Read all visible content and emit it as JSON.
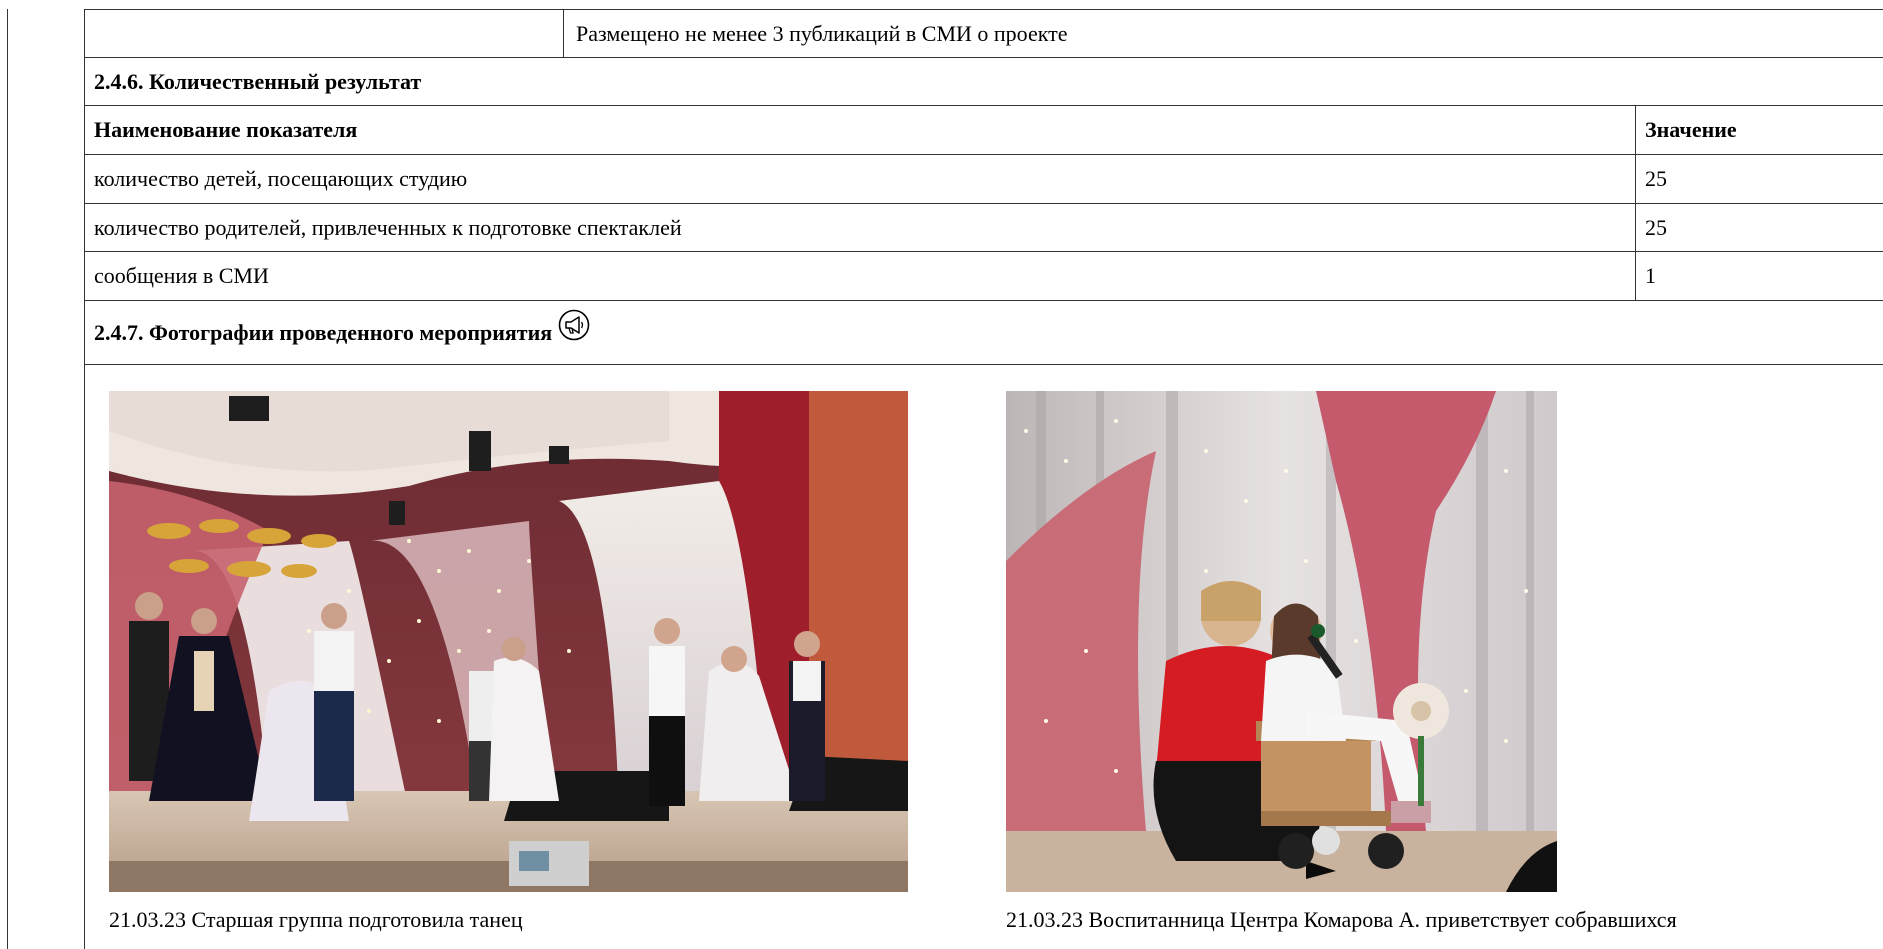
{
  "rows": {
    "publications_note": "Размещено не менее 3 публикаций в СМИ о проекте",
    "quant_section_title": "2.4.6. Количественный результат",
    "indicators_header": {
      "name": "Наименование показателя",
      "value": "Значение"
    },
    "indicators": [
      {
        "name": "количество детей, посещающих студию",
        "value": "25"
      },
      {
        "name": "количество родителей, привлеченных к подготовке спектаклей",
        "value": "25"
      },
      {
        "name": "сообщения в СМИ",
        "value": "1"
      }
    ],
    "photos_section_title": "2.4.7. Фотографии проведенного мероприятия"
  },
  "photos": [
    {
      "caption": "21.03.23 Старшая группа подготовила танец"
    },
    {
      "caption": "21.03.23 Воспитанница Центра Комарова А. приветствует собравшихся"
    }
  ],
  "icons": {
    "section_icon": "megaphone-icon"
  },
  "colors": {
    "border": "#333333",
    "text": "#000000",
    "curtain_red": "#a8203a",
    "curtain_pink": "#d98a96",
    "curtain_white": "#e8e4e6",
    "stage_floor": "#c9b7a0"
  }
}
